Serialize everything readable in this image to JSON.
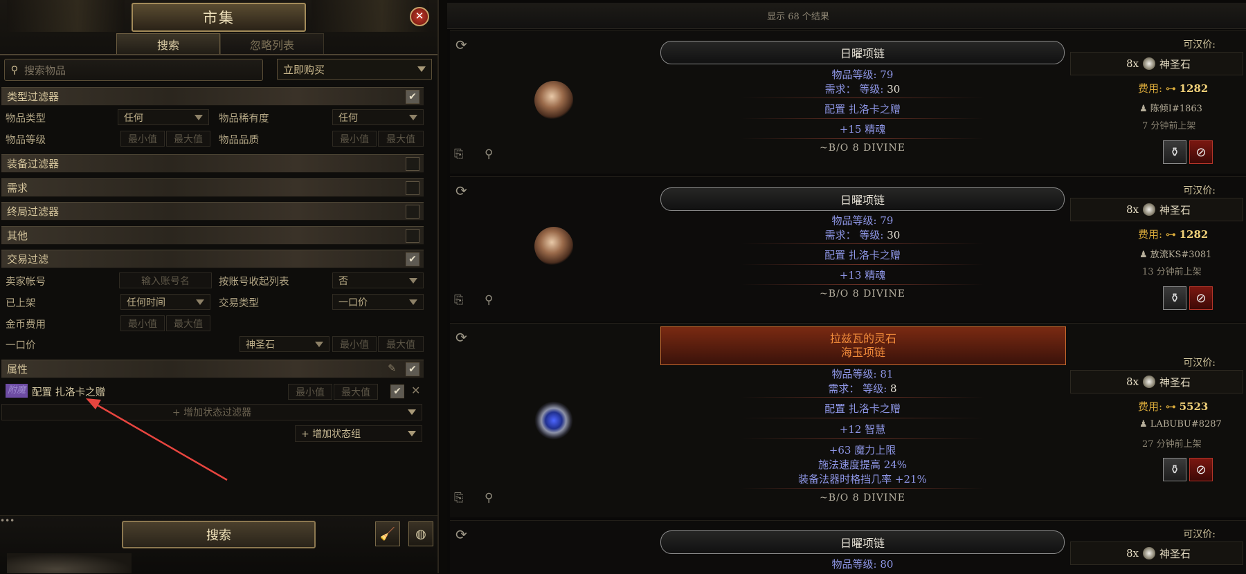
{
  "left": {
    "title": "市集",
    "tabs": {
      "search": "搜索",
      "ignore": "忽略列表"
    },
    "search_placeholder": "搜索物品",
    "buy_mode": "立即购买",
    "sections": {
      "type": "类型过滤器",
      "equipment": "装备过滤器",
      "requirements": "需求",
      "endgame": "终局过滤器",
      "misc": "其他",
      "trade": "交易过滤",
      "stats": "属性"
    },
    "type_filters": {
      "item_category_label": "物品类型",
      "item_category_value": "任何",
      "item_rarity_label": "物品稀有度",
      "item_rarity_value": "任何",
      "item_level_label": "物品等级",
      "item_quality_label": "物品品质",
      "min": "最小值",
      "max": "最大值"
    },
    "trade_filters": {
      "seller_label": "卖家帐号",
      "seller_placeholder": "输入账号名",
      "collapse_label": "按账号收起列表",
      "collapse_value": "否",
      "listed_label": "已上架",
      "listed_value": "任何时间",
      "sale_type_label": "交易类型",
      "sale_type_value": "一口价",
      "gold_label": "金币费用",
      "buyout_label": "一口价",
      "buyout_currency": "神圣石"
    },
    "stat_filter": {
      "tag": "附魔",
      "text": "配置 扎洛卡之赠"
    },
    "add_stat_filter": "+ 增加状态过滤器",
    "add_stat_group": "+ 增加状态组",
    "search_button": "搜索"
  },
  "results": {
    "count_text": "显示 68 个结果",
    "labels": {
      "price": "可汉价:",
      "cost": "费用:",
      "item_level": "物品等级:",
      "requires": "需求：",
      "level": "等级:"
    },
    "items": [
      {
        "name": "日曜项链",
        "item_level": "79",
        "req_level": "30",
        "enchant": "配置 扎洛卡之赠",
        "implicit": "+15 精魂",
        "note": "~B/O 8 DIVINE",
        "price_qty": "8x",
        "price_currency": "神圣石",
        "cost": "1282",
        "seller": "陈倾I#1863",
        "listed": "7 分钟前上架"
      },
      {
        "name": "日曜项链",
        "item_level": "79",
        "req_level": "30",
        "enchant": "配置 扎洛卡之赠",
        "implicit": "+13 精魂",
        "note": "~B/O 8 DIVINE",
        "price_qty": "8x",
        "price_currency": "神圣石",
        "cost": "1282",
        "seller": "放流KS#3081",
        "listed": "13 分钟前上架"
      },
      {
        "name_line1": "拉兹瓦的灵石",
        "name_line2": "海玉项链",
        "item_level": "81",
        "req_level": "8",
        "enchant": "配置 扎洛卡之赠",
        "implicit": "+12 智慧",
        "mods": [
          "+63 魔力上限",
          "施法速度提高 24%",
          "装备法器时格挡几率 +21%"
        ],
        "note": "~B/O 8 DIVINE",
        "price_qty": "8x",
        "price_currency": "神圣石",
        "cost": "5523",
        "seller": "LABUBU#8287",
        "listed": "27 分钟前上架"
      },
      {
        "name": "日曜项链",
        "item_level": "80",
        "price_qty": "8x",
        "price_currency": "神圣石"
      }
    ]
  },
  "colors": {
    "gold_text": "#c9b98f",
    "magic_blue": "#8e96e6",
    "unique_orange": "#f08a3a",
    "cost_gold": "#d8a93a"
  },
  "icons": [
    "close-icon",
    "search-icon",
    "refresh-icon",
    "copy-icon",
    "whisper-icon",
    "bag-icon",
    "block-icon",
    "broom-icon",
    "globe-icon",
    "pencil-icon",
    "check-icon"
  ]
}
